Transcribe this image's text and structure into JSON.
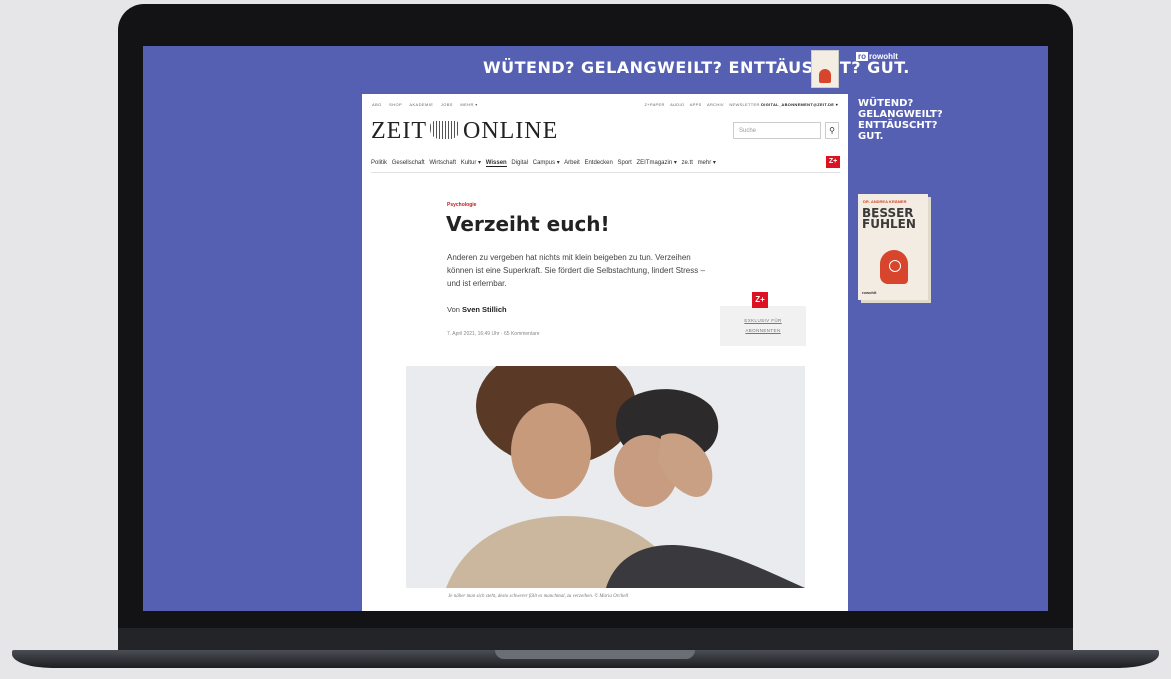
{
  "ad": {
    "banner_text": "WÜTEND? GELANGWEILT? ENTTÄUSCHT? GUT.",
    "publisher": "rowohlt",
    "side_lines": [
      "WÜTEND?",
      "GELANGWEILT?",
      "ENTTÄUSCHT?",
      "GUT."
    ],
    "book_title_lines": [
      "BESSER",
      "FÜHLEN"
    ],
    "book_author_small": "DR. ANDREA KRÄMER"
  },
  "site": {
    "logo_left": "ZEIT",
    "logo_right": "ONLINE",
    "top_nav": [
      "ABO",
      "SHOP",
      "AKADEMIE",
      "JOBS",
      "MEHR ▾"
    ],
    "top_nav_right": [
      "Z+PAPER",
      "AUDIO",
      "APPS",
      "ARCHIV",
      "NEWSLETTER"
    ],
    "account": "DIGITAL_ABONNEMENT@ZEIT.DE ▾",
    "search_placeholder": "Suche",
    "search_icon_glyph": "⚲",
    "main_nav": [
      "Politik",
      "Gesellschaft",
      "Wirtschaft",
      "Kultur ▾",
      "Wissen",
      "Digital",
      "Campus ▾",
      "Arbeit",
      "Entdecken",
      "Sport",
      "ZEITmagazin ▾",
      "ze.tt",
      "mehr ▾"
    ],
    "main_nav_active": "Wissen",
    "zplus_label": "Z+"
  },
  "article": {
    "kicker": "Psychologie",
    "title": "Verzeiht euch!",
    "lead": "Anderen zu vergeben hat nichts mit klein beigeben zu tun. Verzeihen können ist eine Superkraft. Sie fördert die Selbstachtung, lindert Stress – und ist erlernbar.",
    "author_prefix": "Von",
    "author_name": "Sven Stillich",
    "date": "7. April 2021, 16:49 Uhr",
    "comments": "65 Kommentare",
    "exclusive_line1": "EXKLUSIV FÜR",
    "exclusive_line2": "ABONNENTEN",
    "caption": "Je näher man sich steht, desto schwerer fällt es manchmal, zu verzeihen. © Maria Orchell"
  },
  "colors": {
    "ad_background": "#5660b3",
    "accent_red": "#d12222"
  }
}
